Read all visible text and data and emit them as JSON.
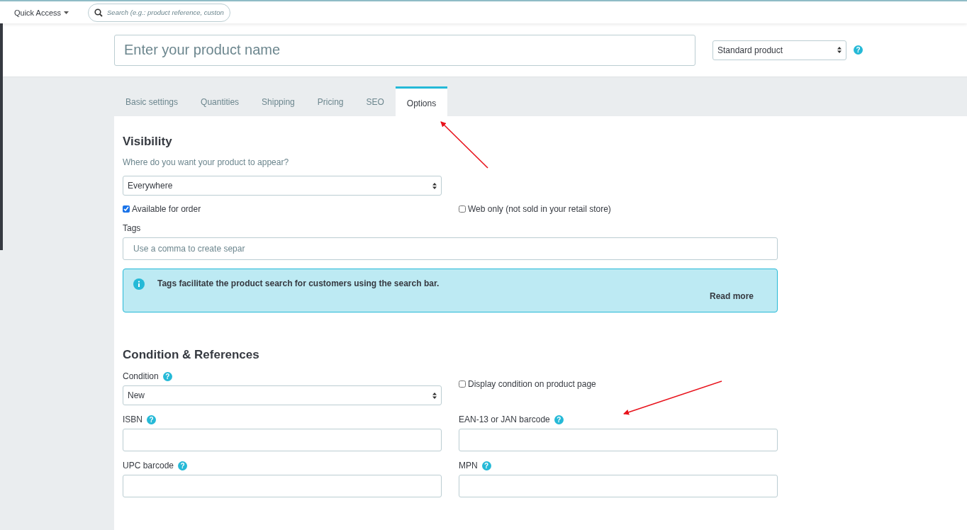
{
  "top_bar": {
    "quick_access": "Quick Access",
    "search": {
      "placeholder": "Search (e.g.: product reference, custon"
    }
  },
  "header": {
    "product_name": {
      "placeholder": "Enter your product name"
    },
    "product_type": {
      "value": "Standard product"
    },
    "help": "?"
  },
  "tabs": [
    {
      "label": "Basic settings",
      "selected": false
    },
    {
      "label": "Quantities",
      "selected": false
    },
    {
      "label": "Shipping",
      "selected": false
    },
    {
      "label": "Pricing",
      "selected": false
    },
    {
      "label": "SEO",
      "selected": false
    },
    {
      "label": "Options",
      "selected": true
    }
  ],
  "visibility": {
    "title": "Visibility",
    "subtitle": "Where do you want your product to appear?",
    "select": {
      "value": "Everywhere"
    },
    "checkboxes": [
      {
        "label": "Available for order",
        "checked": true
      },
      {
        "label": "Web only (not sold in your retail store)",
        "checked": false
      }
    ],
    "tags": {
      "label": "Tags",
      "placeholder": "Use a comma to create separ"
    },
    "alert": {
      "text": "Tags facilitate the product search for customers using the search bar.",
      "link": "Read more"
    }
  },
  "condition": {
    "title": "Condition & References",
    "condition": {
      "label": "Condition",
      "help": "?",
      "value": "New"
    },
    "display_checkbox": {
      "label": "Display condition on product page",
      "checked": false
    },
    "fields": [
      {
        "label": "ISBN",
        "help": "?"
      },
      {
        "label": "EAN-13 or JAN barcode",
        "help": "?"
      },
      {
        "label": "UPC barcode",
        "help": "?"
      },
      {
        "label": "MPN",
        "help": "?"
      }
    ]
  }
}
